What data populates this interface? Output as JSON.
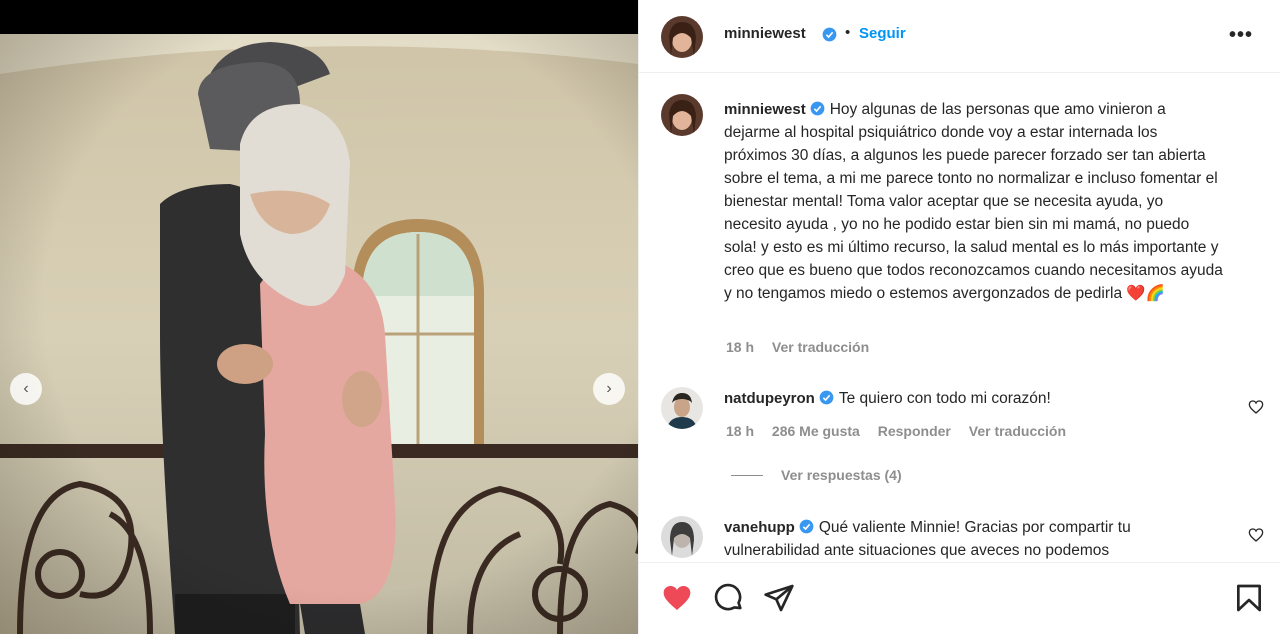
{
  "post": {
    "author": {
      "username": "minniewest",
      "follow_label": "Seguir",
      "separator": "•"
    },
    "caption": {
      "username": "minniewest",
      "text": "Hoy algunas de las personas que amo vinieron a dejarme al hospital psiquiátrico donde voy a estar internada los próximos 30 días, a algunos les puede parecer forzado ser tan abierta sobre el tema, a mi me parece tonto no normalizar e incluso fomentar el bienestar mental! Toma valor aceptar que se necesita ayuda, yo necesito ayuda , yo no he podido estar bien sin mi mamá, no puedo sola! y esto es mi último recurso, la salud mental es lo más importante y creo que es bueno que todos reconozcamos cuando necesitamos ayuda y no tengamos miedo o estemos avergonzados de pedirla",
      "emojis": "❤️🌈",
      "time": "18 h",
      "translate_label": "Ver traducción"
    },
    "comments": [
      {
        "username": "natdupeyron",
        "text": "Te quiero con todo mi corazón!",
        "time": "18 h",
        "likes": "286 Me gusta",
        "reply_label": "Responder",
        "translate_label": "Ver traducción",
        "replies_label": "Ver respuestas (4)"
      },
      {
        "username": "vanehupp",
        "text": "Qué valiente Minnie! Gracias por compartir tu vulnerabilidad ante situaciones que aveces no podemos"
      }
    ]
  },
  "colors": {
    "accent": "#0095f6",
    "verified": "#3897f0",
    "like_red": "#ed4956",
    "muted": "#8e8e8e",
    "text": "#262626"
  },
  "icons": {
    "more": "more-options-icon",
    "like": "heart-filled-icon",
    "comment": "comment-bubble-icon",
    "share": "paper-plane-icon",
    "save": "bookmark-icon",
    "verified": "verified-badge-icon",
    "prev": "chevron-left-icon",
    "next": "chevron-right-icon"
  },
  "carousel": {
    "prev_glyph": "‹",
    "next_glyph": "›"
  }
}
